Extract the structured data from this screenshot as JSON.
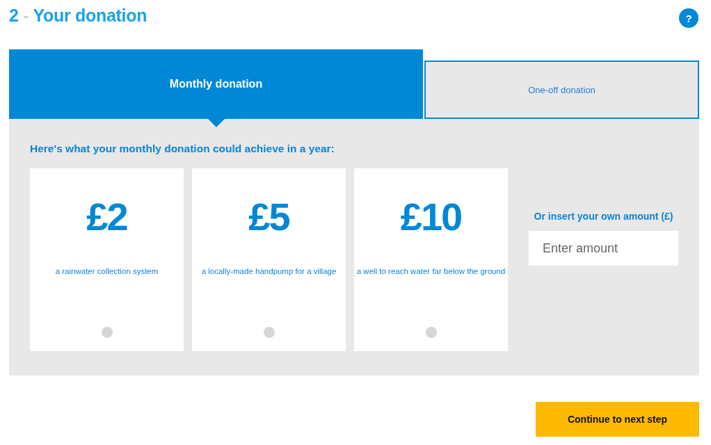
{
  "heading": {
    "step": "2",
    "separator": "-",
    "title": "Your donation"
  },
  "help_button": {
    "label": "?"
  },
  "tabs": [
    {
      "label": "Monthly donation",
      "selected": true
    },
    {
      "label": "One-off donation",
      "selected": false
    }
  ],
  "intro": "Here's what your monthly donation could achieve in a year:",
  "options": [
    {
      "amount": "£2",
      "description": "a rainwater collection system",
      "selected": false
    },
    {
      "amount": "£5",
      "description": "a locally-made handpump for a village",
      "selected": false
    },
    {
      "amount": "£10",
      "description": "a well to reach water far below the ground",
      "selected": false
    }
  ],
  "custom_amount": {
    "label": "Or insert your own amount (£)",
    "placeholder": "Enter amount"
  },
  "continue_button": {
    "label": "Continue to next step"
  }
}
